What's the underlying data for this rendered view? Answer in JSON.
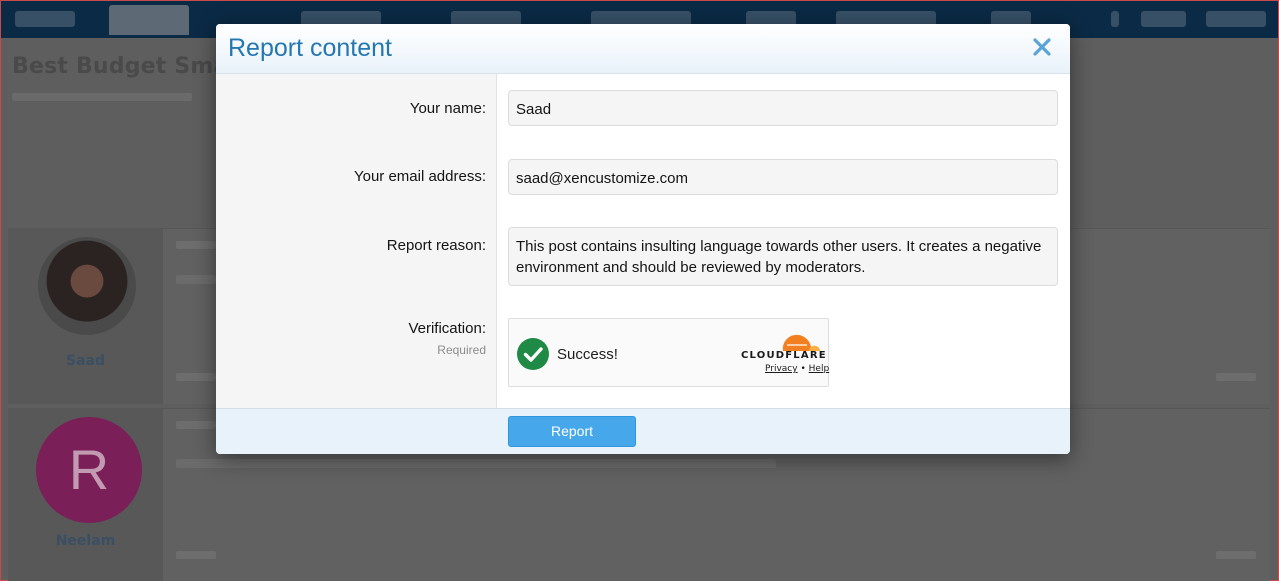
{
  "background": {
    "thread_title": "Best Budget Smar",
    "posts": [
      {
        "username": "Saad",
        "avatar_initial": ""
      },
      {
        "username": "Neelam",
        "avatar_initial": "R"
      }
    ]
  },
  "modal": {
    "title": "Report content",
    "close_icon": "close-x-icon",
    "fields": {
      "name": {
        "label": "Your name:",
        "value": "Saad"
      },
      "email": {
        "label": "Your email address:",
        "value": "saad@xencustomize.com"
      },
      "reason": {
        "label": "Report reason:",
        "value": "This post contains insulting language towards other users. It creates a negative environment and should be reviewed by moderators."
      },
      "verification": {
        "label": "Verification:",
        "hint": "Required"
      }
    },
    "captcha": {
      "status": "Success!",
      "brand": "CLOUDFLARE",
      "privacy": "Privacy",
      "separator": "•",
      "help": "Help"
    },
    "submit_label": "Report"
  },
  "colors": {
    "accent": "#2577b1",
    "button": "#47a7eb",
    "success": "#1e8a46",
    "cloudflare": "#f38020"
  }
}
